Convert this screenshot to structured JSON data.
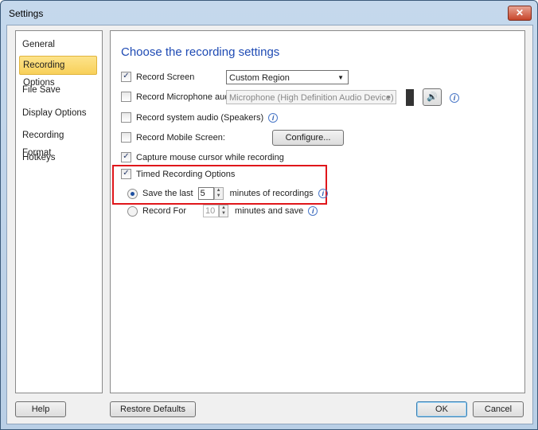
{
  "window": {
    "title": "Settings",
    "close": "✕"
  },
  "sidebar": {
    "items": [
      {
        "label": "General"
      },
      {
        "label": "Recording Options"
      },
      {
        "label": "File Save"
      },
      {
        "label": "Display Options"
      },
      {
        "label": "Recording Format"
      },
      {
        "label": "Hotkeys"
      }
    ],
    "selected": "Recording Options"
  },
  "main": {
    "heading": "Choose the recording settings",
    "record_screen": {
      "label": "Record Screen",
      "checked": true,
      "value": "Custom Region"
    },
    "record_mic": {
      "label": "Record Microphone audio",
      "checked": false,
      "value": "Microphone (High Definition Audio Device)"
    },
    "record_system": {
      "label": "Record system audio (Speakers)",
      "checked": false
    },
    "record_mobile": {
      "label": "Record Mobile Screen:",
      "checked": false,
      "button": "Configure..."
    },
    "capture_mouse": {
      "label": "Capture mouse cursor while recording",
      "checked": true
    },
    "timed": {
      "label": "Timed Recording Options",
      "checked": true
    },
    "save_last": {
      "label": "Save the last",
      "value": "5",
      "suffix": "minutes of recordings",
      "selected": true
    },
    "record_for": {
      "label": "Record For",
      "value": "10",
      "suffix": "minutes and save",
      "selected": false
    },
    "info": "i"
  },
  "footer": {
    "help": "Help",
    "restore": "Restore Defaults",
    "ok": "OK",
    "cancel": "Cancel"
  }
}
